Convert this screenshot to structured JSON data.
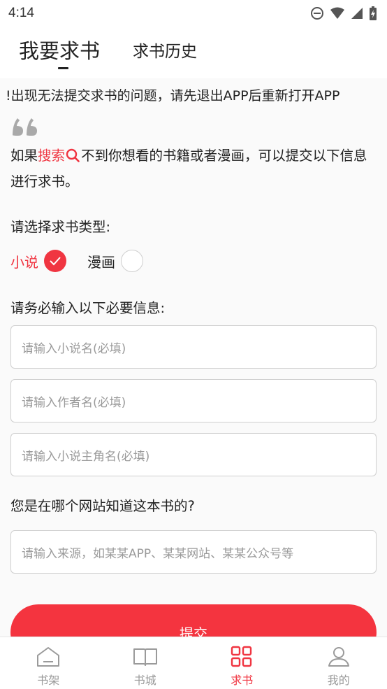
{
  "status_bar": {
    "time": "4:14"
  },
  "tabs": {
    "main": "我要求书",
    "history": "求书历史"
  },
  "notice": "!出现无法提交求书的问题，请先退出APP后重新打开APP",
  "intro": {
    "prefix": "如果",
    "highlight": "搜索",
    "suffix": "不到你想看的书籍或者漫画，可以提交以下信息进行求书。"
  },
  "type_section": {
    "label": "请选择求书类型:",
    "options": [
      {
        "label": "小说",
        "selected": true
      },
      {
        "label": "漫画",
        "selected": false
      }
    ]
  },
  "required_label": "请务必输入以下必要信息:",
  "fields": {
    "novel_name_placeholder": "请输入小说名(必填)",
    "author_placeholder": "请输入作者名(必填)",
    "protagonist_placeholder": "请输入小说主角名(必填)"
  },
  "source_label": "您是在哪个网站知道这本书的?",
  "source_placeholder": "请输入来源，如某某APP、某某网站、某某公众号等",
  "submit_label": "提交",
  "bottom_nav": [
    {
      "label": "书架",
      "icon": "bookshelf-icon",
      "active": false
    },
    {
      "label": "书城",
      "icon": "book-icon",
      "active": false
    },
    {
      "label": "求书",
      "icon": "grid-icon",
      "active": true
    },
    {
      "label": "我的",
      "icon": "user-icon",
      "active": false
    }
  ],
  "colors": {
    "accent": "#f03541",
    "button": "#f4343f"
  }
}
